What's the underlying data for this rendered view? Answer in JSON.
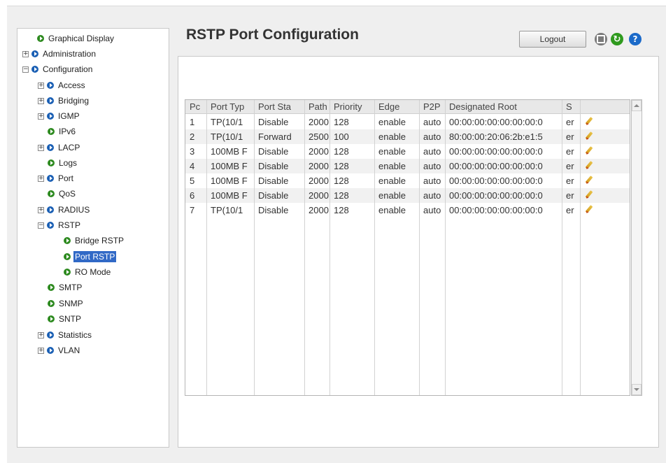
{
  "page": {
    "title": "RSTP Port Configuration",
    "logout_label": "Logout"
  },
  "toolbar_icons": [
    "save-icon",
    "refresh-icon",
    "help-icon"
  ],
  "colors": {
    "selected_bg": "#3169c6",
    "node_icon_blue": "#1a5fb4",
    "node_icon_green": "#2d8a1f"
  },
  "tree": {
    "graphical_display": "Graphical Display",
    "administration": "Administration",
    "configuration": "Configuration",
    "access": "Access",
    "bridging": "Bridging",
    "igmp": "IGMP",
    "ipv6": "IPv6",
    "lacp": "LACP",
    "logs": "Logs",
    "port": "Port",
    "qos": "QoS",
    "radius": "RADIUS",
    "rstp": "RSTP",
    "bridge_rstp": "Bridge RSTP",
    "port_rstp": "Port RSTP",
    "ro_mode": "RO Mode",
    "smtp": "SMTP",
    "snmp": "SNMP",
    "sntp": "SNTP",
    "statistics": "Statistics",
    "vlan": "VLAN",
    "expand_plus": "+",
    "expand_minus": "−"
  },
  "table": {
    "headers": [
      "Pc",
      "Port Typ",
      "Port Sta",
      "Path",
      "Priority",
      "Edge",
      "P2P",
      "Designated Root",
      "S"
    ],
    "rows": [
      [
        "1",
        "TP(10/1",
        "Disable",
        "2000",
        "128",
        "enable",
        "auto",
        "00:00:00:00:00:00:00:0",
        "er"
      ],
      [
        "2",
        "TP(10/1",
        "Forward",
        "2500",
        "100",
        "enable",
        "auto",
        "80:00:00:20:06:2b:e1:5",
        "er"
      ],
      [
        "3",
        "100MB F",
        "Disable",
        "2000",
        "128",
        "enable",
        "auto",
        "00:00:00:00:00:00:00:0",
        "er"
      ],
      [
        "4",
        "100MB F",
        "Disable",
        "2000",
        "128",
        "enable",
        "auto",
        "00:00:00:00:00:00:00:0",
        "er"
      ],
      [
        "5",
        "100MB F",
        "Disable",
        "2000",
        "128",
        "enable",
        "auto",
        "00:00:00:00:00:00:00:0",
        "er"
      ],
      [
        "6",
        "100MB F",
        "Disable",
        "2000",
        "128",
        "enable",
        "auto",
        "00:00:00:00:00:00:00:0",
        "er"
      ],
      [
        "7",
        "TP(10/1",
        "Disable",
        "2000",
        "128",
        "enable",
        "auto",
        "00:00:00:00:00:00:00:0",
        "er"
      ]
    ]
  }
}
